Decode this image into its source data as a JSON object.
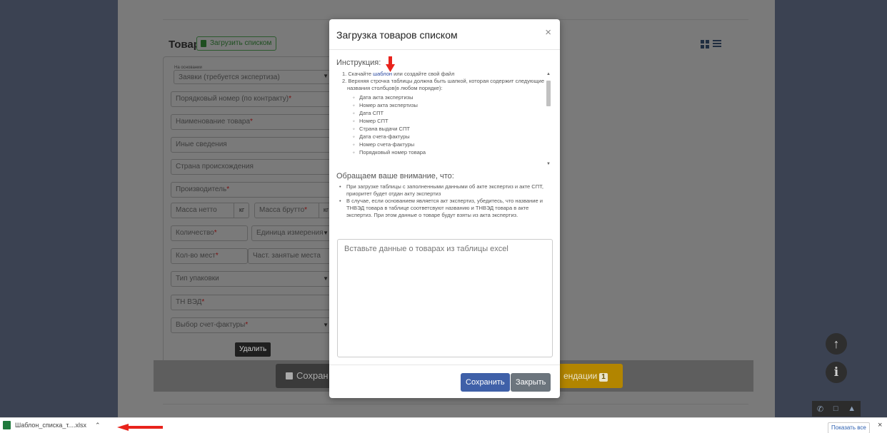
{
  "page": {
    "section_title": "Товар",
    "load_list_button": "Загрузить списком",
    "form": {
      "basis_label": "На основании",
      "basis_value": "Заявки (требуется экспертиза)",
      "fields": [
        {
          "label": "Порядковый номер (по контракту)",
          "required": true
        },
        {
          "label": "Наименование товара",
          "required": true
        },
        {
          "label": "Иные сведения",
          "required": false
        },
        {
          "label": "Страна происхождения",
          "required": false
        },
        {
          "label": "Производитель",
          "required": true
        }
      ],
      "mass_net": "Масса нетто",
      "mass_gross": "Масса брутто",
      "unit_kg": "кг",
      "quantity": "Количество",
      "unit_of_measure": "Единица измерения",
      "places_count": "Кол-во мест",
      "partial_places": "Част. занятые места",
      "package_type": "Тип упаковки",
      "hs_code": "ТН ВЭД",
      "invoice_select": "Выбор счет-фактуры",
      "required_mark": "*"
    },
    "delete_button": "Удалить",
    "save_button": "Сохран",
    "recommend_button": "ендации",
    "recommend_count": "1",
    "up_icon": "↑",
    "info_icon": "i"
  },
  "modal": {
    "title": "Загрузка товаров списком",
    "close_symbol": "×",
    "instruction_heading": "Инструкция:",
    "step1_prefix": "1. Скачайте ",
    "step1_link": "шаблон",
    "step1_suffix": " или создайте свой файл",
    "step2": "2. Верхняя строчка таблицы должна быть шапкой, которая содержит следующие названия столбцов(в любом порядке):",
    "columns": [
      "Дата акта экспертизы",
      "Номер акта экспертизы",
      "Дата СПТ",
      "Номер СПТ",
      "Страна выдачи СПТ",
      "Дата счета-фактуры",
      "Номер счета-фактуры",
      "Порядковый номер товара"
    ],
    "attention_heading": "Обращаем ваше внимание, что:",
    "attention_items": [
      "При загрузке таблицы с заполненными данными об акте экспертиз и акте СПТ, приоритет будет отдан акту экспертиз",
      "В случае, если основанием является акт экспертиз, убедитесь, что название и ТНВЭД товара в таблице соответсвуют названию и ТНВЭД товара в акте экспертиз. При этом данные о товаре будут взяты из акта экспертиз."
    ],
    "textarea_placeholder": "Вставьте данные о товарах из таблицы excel",
    "save_button": "Сохранить",
    "close_button": "Закрыть"
  },
  "download_bar": {
    "file_name": "Шаблон_списка_т....xlsx",
    "show_all": "Показать все",
    "close_symbol": "×"
  },
  "colors": {
    "primary": "#3f60a8",
    "secondary": "#6c757d",
    "annotation_arrow": "#e8231c",
    "excel_green": "#1f7a3c",
    "warning": "#b28500"
  },
  "icons": [
    "grid-view-icon",
    "list-view-icon",
    "excel-file-icon",
    "floppy-disk-icon",
    "arrow-up-icon",
    "info-icon",
    "phone-icon",
    "chat-icon",
    "bell-icon"
  ]
}
